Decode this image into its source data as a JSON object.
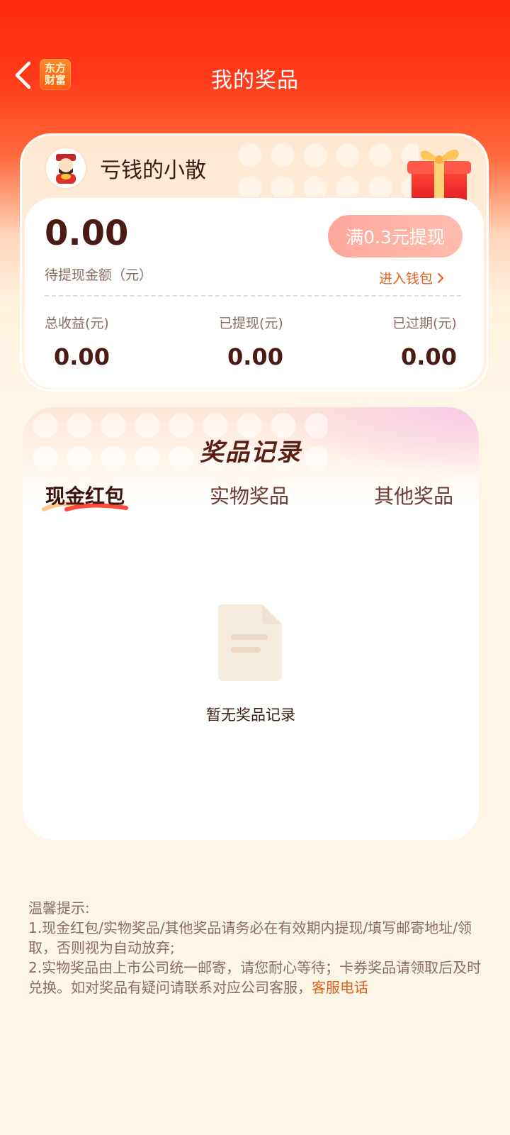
{
  "header": {
    "title": "我的奖品",
    "logo_line1": "东方",
    "logo_line2": "财富"
  },
  "user": {
    "name": "亏钱的小散"
  },
  "wallet": {
    "balance": "0.00",
    "balance_label": "待提现金额（元）",
    "withdraw_button": "满0.3元提现",
    "wallet_link": "进入钱包",
    "stats": [
      {
        "label": "总收益(元)",
        "value": "0.00"
      },
      {
        "label": "已提现(元)",
        "value": "0.00"
      },
      {
        "label": "已过期(元)",
        "value": "0.00"
      }
    ]
  },
  "records": {
    "title": "奖品记录",
    "tabs": [
      {
        "label": "现金红包",
        "active": true
      },
      {
        "label": "实物奖品",
        "active": false
      },
      {
        "label": "其他奖品",
        "active": false
      }
    ],
    "empty_text": "暂无奖品记录"
  },
  "tips": {
    "heading": "温馨提示:",
    "line1": "1.现金红包/实物奖品/其他奖品请务必在有效期内提现/填写邮寄地址/领取，否则视为自动放弃;",
    "line2": "2.实物奖品由上市公司统一邮寄，请您耐心等待；卡券奖品请领取后及时兑换。如对奖品有疑问请联系对应公司客服，",
    "link": "客服电话"
  },
  "colors": {
    "header_red": "#ff2a0e",
    "accent_orange": "#e3611c",
    "text_dark": "#4b1a14",
    "withdraw_pink": "#ffa79c"
  },
  "icons": {
    "back": "chevron-left-icon",
    "wallet_arrow": "chevron-right-icon",
    "empty": "document-icon",
    "gift": "gift-box-icon",
    "avatar": "fortune-god-avatar"
  }
}
